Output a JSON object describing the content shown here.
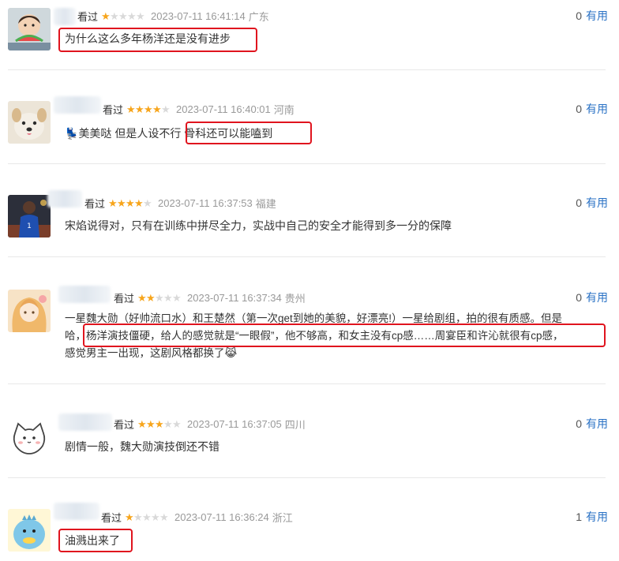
{
  "comments": [
    {
      "watched": "看过",
      "stars": 1,
      "time": "2023-07-11 16:41:14",
      "location": "广东",
      "text": "为什么这么多年杨洋还是没有进步",
      "useful_count": "0",
      "useful_label": "有用",
      "avatar": "child-eating-watermelon-avatar"
    },
    {
      "watched": "看过",
      "stars": 4,
      "time": "2023-07-11 16:40:01",
      "location": "河南",
      "emoji": "💺",
      "text": "美美哒 但是人设不行 骨科还可以能嗑到",
      "useful_count": "0",
      "useful_label": "有用",
      "avatar": "puppy-avatar"
    },
    {
      "watched": "看过",
      "stars": 4,
      "time": "2023-07-11 16:37:53",
      "location": "福建",
      "text": "宋焰说得对，只有在训练中拼尽全力，实战中自己的安全才能得到多一分的保障",
      "useful_count": "0",
      "useful_label": "有用",
      "avatar": "basketball-player-avatar"
    },
    {
      "watched": "看过",
      "stars": 2,
      "time": "2023-07-11 16:37:34",
      "location": "贵州",
      "lines": [
        "一星魏大勋（好帅流口水）和王楚然（第一次get到她的美貌，好漂亮!）一星给剧组，拍的很有质感。但是",
        "哈，杨洋演技僵硬，给人的感觉就是“一眼假”，他不够高，和女主没有cp感……周宴臣和许沁就很有cp感，",
        "感觉男主一出现，这剧风格都换了"
      ],
      "end_emoji": "😹",
      "useful_count": "0",
      "useful_label": "有用",
      "avatar": "anime-girl-avatar"
    },
    {
      "watched": "看过",
      "stars": 3,
      "time": "2023-07-11 16:37:05",
      "location": "四川",
      "text": "剧情一般，魏大勋演技倒还不错",
      "useful_count": "0",
      "useful_label": "有用",
      "avatar": "white-cat-avatar"
    },
    {
      "watched": "看过",
      "stars": 1,
      "time": "2023-07-11 16:36:24",
      "location": "浙江",
      "text": "油溅出来了",
      "useful_count": "1",
      "useful_label": "有用",
      "avatar": "blue-dinosaur-avatar"
    }
  ],
  "colors": {
    "accent": "#2a72c5",
    "star": "#f7a51c",
    "highlight": "#e0141e"
  }
}
